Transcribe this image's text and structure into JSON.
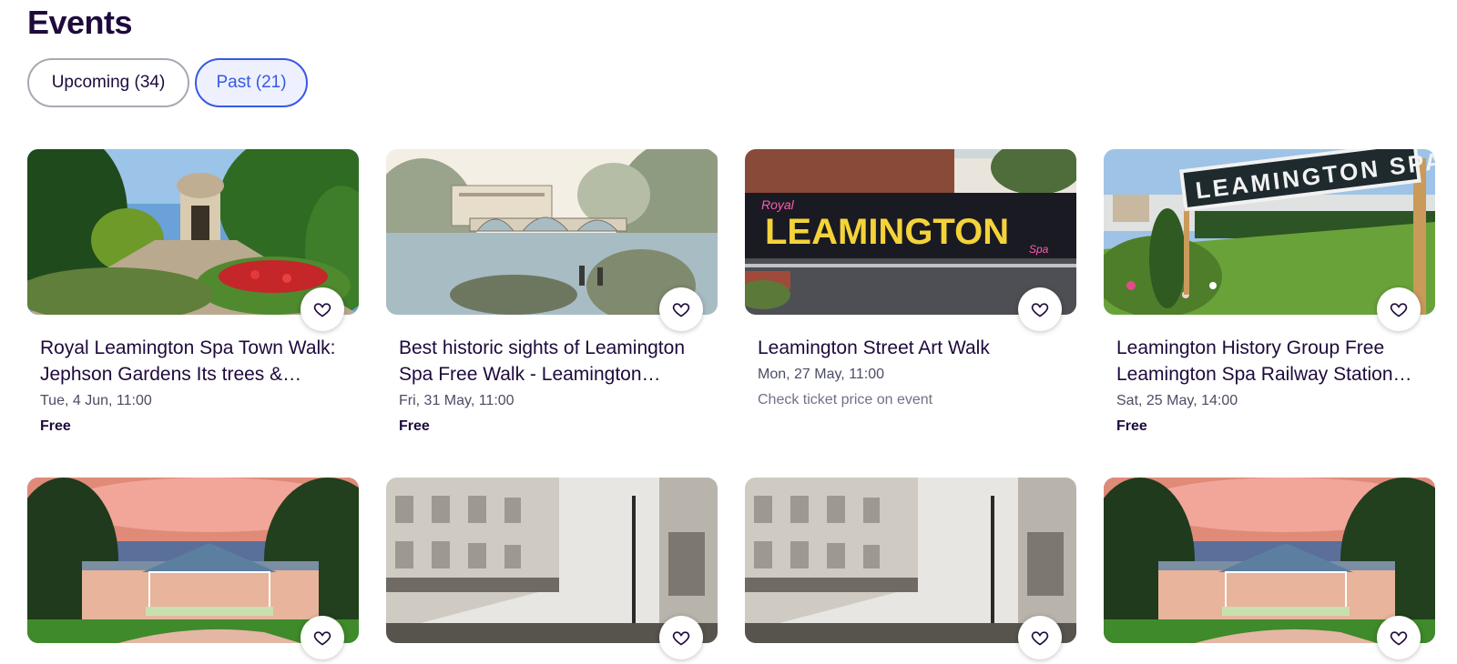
{
  "page": {
    "title": "Events"
  },
  "tabs": [
    {
      "label": "Upcoming (34)",
      "active": false
    },
    {
      "label": "Past (21)",
      "active": true
    }
  ],
  "events": [
    {
      "title": "Royal Leamington Spa Town Walk: Jephson Gardens Its trees &…",
      "date": "Tue, 4 Jun, 11:00",
      "price": "Free",
      "image": "jephson-gardens-temple"
    },
    {
      "title": "Best historic sights of Leamington Spa Free Walk - Leamington…",
      "date": "Fri, 31 May, 11:00",
      "price": "Free",
      "image": "bridge-engraving"
    },
    {
      "title": "Leamington Street Art Walk",
      "date": "Mon, 27 May, 11:00",
      "price": "Check ticket price on event",
      "image": "leamington-mural",
      "mural_text": "LEAMINGTON",
      "mural_small_1": "Royal",
      "mural_small_2": "Spa"
    },
    {
      "title": "Leamington History Group Free Leamington Spa Railway Station…",
      "date": "Sat, 25 May, 14:00",
      "price": "Free",
      "image": "railway-station-sign",
      "sign_text": "LEAMINGTON SPA"
    },
    {
      "image": "bandstand-sunset"
    },
    {
      "image": "historic-street-photo"
    },
    {
      "image": "historic-street-photo"
    },
    {
      "image": "bandstand-sunset"
    }
  ],
  "icons": {
    "favorite": "heart-outline-icon"
  },
  "colors": {
    "brand_blue": "#3659e3",
    "text_dark": "#1e0a3c",
    "muted": "#6f7287"
  }
}
